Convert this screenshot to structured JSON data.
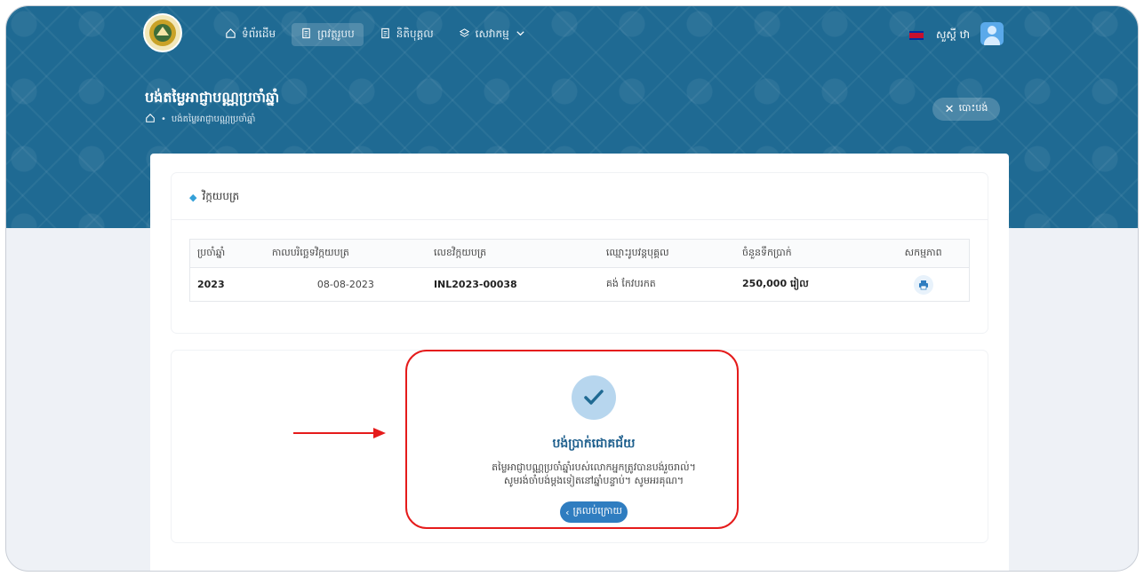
{
  "nav": {
    "items": [
      {
        "label": "ទំព័រដើម",
        "icon": "home-icon",
        "active": false
      },
      {
        "label": "ព្រវត្តរូបប",
        "icon": "document-icon",
        "active": true
      },
      {
        "label": "និតិបុគ្គល",
        "icon": "document-icon",
        "active": false
      },
      {
        "label": "សេវាកម្ម",
        "icon": "layers-icon",
        "active": false
      }
    ],
    "user_name": "សួស្តី ឋា"
  },
  "header": {
    "title": "បង់តម្លៃអាជ្ញាបណ្ណប្រចាំឆ្នាំ",
    "breadcrumb": "បង់តម្លៃអាជ្ញាបណ្ណប្រចាំឆ្នាំ",
    "close_label": "បោះបង់"
  },
  "invoice": {
    "section_title": "វិក្កយបត្រ",
    "columns": [
      "ប្រចាំឆ្នាំ",
      "កាលបរិច្ឆេទវិក្កយបត្រ",
      "លេខវិក្កយបត្រ",
      "ឈ្មោះរូបវន្តបុគ្គល",
      "ចំនួនទឹកប្រាក់",
      "សកម្មភាព"
    ],
    "row": {
      "year": "2023",
      "date": "08-08-2023",
      "number": "INL2023-00038",
      "name": "គង់ កែវបរកត",
      "amount": "250,000 រៀល"
    }
  },
  "success": {
    "title": "បង់ប្រាក់ជោគជ័យ",
    "message_line1": "តម្លៃអាជ្ញាបណ្ណប្រចាំឆ្នាំរបស់លោកអ្នកត្រូវបានបង់រួចរាល់។",
    "message_line2": "សូមរង់ចាំបង់ម្ដងទៀតនៅឆ្នាំបន្ទាប់។ សូមអរគុណ។",
    "back_label": "ត្រលប់ក្រោយ"
  },
  "colors": {
    "header_bg": "#1f6a93",
    "accent": "#2f7dc0",
    "highlight": "#e51b1b"
  }
}
